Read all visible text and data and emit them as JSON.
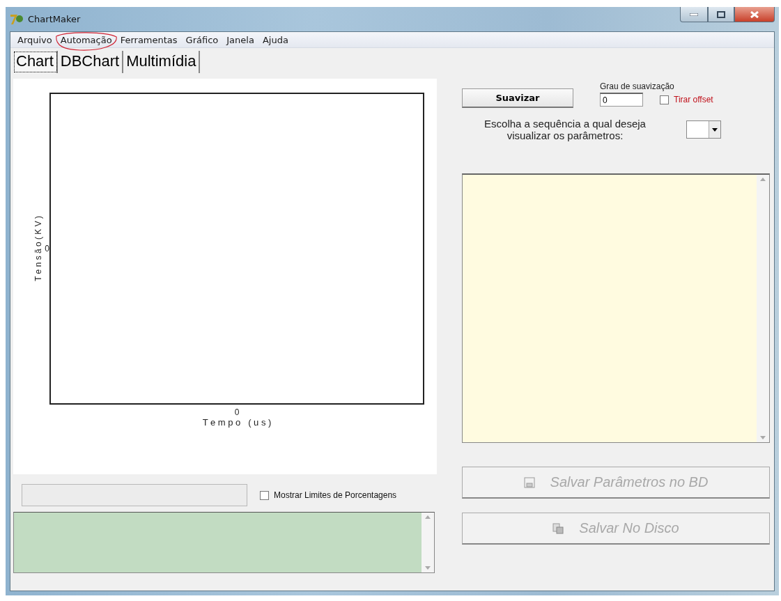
{
  "window": {
    "title": "ChartMaker"
  },
  "menu": [
    {
      "label": "Arquivo",
      "circled": false
    },
    {
      "label": "Automação",
      "circled": true
    },
    {
      "label": "Ferramentas",
      "circled": false
    },
    {
      "label": "Gráfico",
      "circled": false
    },
    {
      "label": "Janela",
      "circled": false
    },
    {
      "label": "Ajuda",
      "circled": false
    }
  ],
  "tabs": [
    {
      "label": "Chart",
      "selected": true
    },
    {
      "label": "DBChart",
      "selected": false
    },
    {
      "label": "Multimídia",
      "selected": false
    }
  ],
  "chart": {
    "x_axis_title": "T e m p o   ( u s )",
    "y_axis_title": "T e n s ã o   ( K V )",
    "x_tick": "0",
    "y_tick": "0"
  },
  "percent_limits": {
    "label": "Mostrar Limites de Porcentagens",
    "checked": false
  },
  "smooth_button": {
    "label": "Suavizar"
  },
  "smooth_degree": {
    "label": "Grau de suavização",
    "value": "0"
  },
  "offset": {
    "label": "Tirar offset",
    "checked": false
  },
  "sequence": {
    "label": "Escolha a sequência a qual deseja visualizar os parâmetros:"
  },
  "actions": [
    {
      "label": "Salvar Parâmetros no BD",
      "kind": "save",
      "disabled": true
    },
    {
      "label": "Salvar No Disco",
      "kind": "disk",
      "disabled": true
    }
  ]
}
